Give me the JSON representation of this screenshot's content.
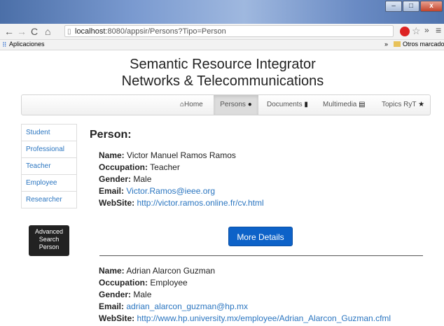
{
  "browser": {
    "url_host": "localhost",
    "url_rest": ":8080/appsir/Persons?Tipo=Person",
    "bookmarks_apps": "Aplicaciones",
    "bookmarks_other": "Otros marcadores",
    "bookmarks_overflow": "»",
    "window_min": "–",
    "window_max": "□",
    "window_close": "x"
  },
  "site": {
    "title_line1": "Semantic Resource Integrator",
    "title_line2": "Networks & Telecommunications"
  },
  "nav": {
    "home": "Home",
    "persons": "Persons",
    "documents": "Documents",
    "multimedia": "Multimedia",
    "topics": "Topics RyT"
  },
  "sidebar": {
    "items": [
      "Student",
      "Professional",
      "Teacher",
      "Employee",
      "Researcher"
    ],
    "advanced": "Advanced Search Person"
  },
  "main": {
    "heading": "Person:",
    "labels": {
      "name": "Name:",
      "occupation": "Occupation:",
      "gender": "Gender:",
      "email": "Email:",
      "website": "WebSite:"
    },
    "more_details": "More Details",
    "persons": [
      {
        "name": "Victor Manuel Ramos Ramos",
        "occupation": "Teacher",
        "gender": "Male",
        "email": "Victor.Ramos@ieee.org",
        "website": "http://victor.ramos.online.fr/cv.html"
      },
      {
        "name": "Adrian Alarcon Guzman",
        "occupation": "Employee",
        "gender": "Male",
        "email": "adrian_alarcon_guzman@hp.mx",
        "website": "http://www.hp.university.mx/employee/Adrian_Alarcon_Guzman.cfml"
      }
    ]
  }
}
